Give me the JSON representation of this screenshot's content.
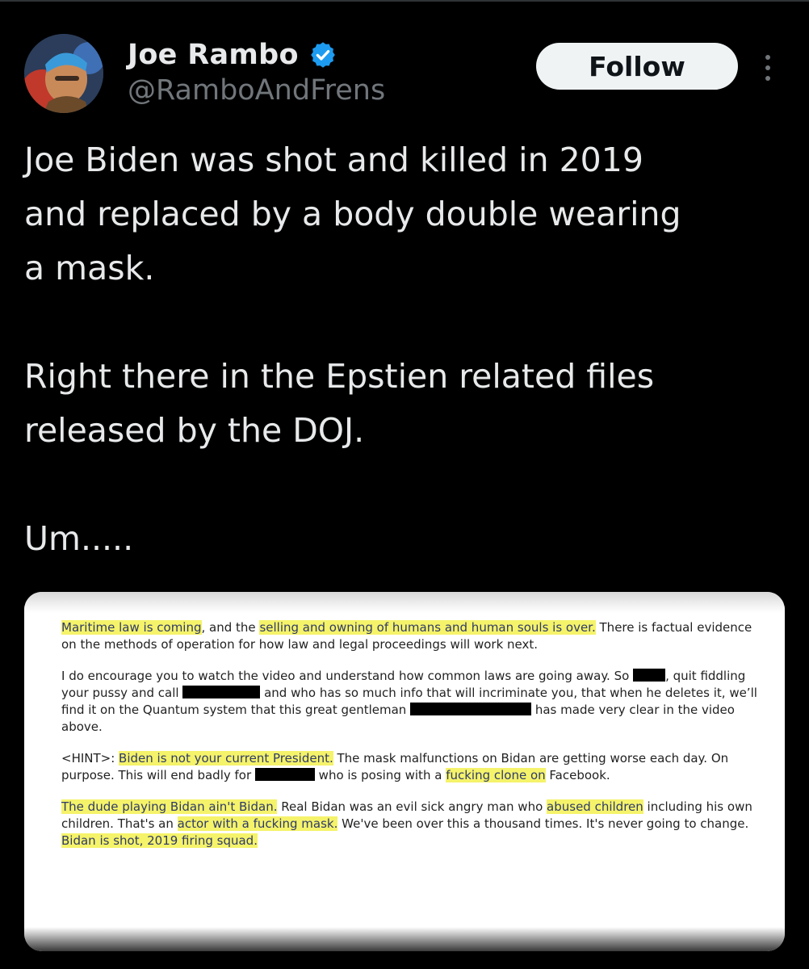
{
  "author": {
    "name": "Joe Rambo",
    "handle": "@RamboAndFrens",
    "verified_color": "#1d9bf0"
  },
  "follow_label": "Follow",
  "more_icon": "more-vertical-icon",
  "tweet_text": "Joe Biden was shot and killed in 2019\nand replaced by a body double wearing\na mask.\n\nRight there in the Epstien related files\nreleased by the DOJ.\n\nUm.....",
  "document": {
    "p1": {
      "hl1": "Maritime law is coming",
      "t1": ", and the ",
      "hl2": "selling and owning of humans and human souls is over.",
      "t2": " There is factual evidence on the methods of operation for how law and legal proceedings will work next."
    },
    "p2": {
      "t1": "I do encourage you to watch the video and understand how common laws are going away. So ",
      "t2": ", quit fiddling your pussy and call ",
      "t3": " and who has so much info that will incriminate you, that when he deletes it, we’ll find it on the Quantum system that this great gentleman ",
      "t4": " has made very clear in the video above."
    },
    "p3": {
      "t1": "<HINT>: ",
      "hl1": "Biden is not your current President.",
      "t2": " The mask malfunctions on Bidan are getting worse each day. On purpose. This will end badly for ",
      "t3": " who is posing with a ",
      "hl2": "fucking clone on",
      "t4": " Facebook."
    },
    "p4": {
      "hl1": "The dude playing Bidan ain't Bidan.",
      "t1": " Real Bidan was an evil sick angry man who ",
      "hl2": "abused children",
      "t2": " including his own children. That's an ",
      "hl3": "actor with a fucking mask.",
      "t3": " We've been over this a thousand times. It's never going to change. ",
      "hl4": "Bidan is shot, 2019 firing squad."
    }
  },
  "colors": {
    "background": "#000000",
    "text": "#e7e9ea",
    "secondary": "#71767b",
    "highlight": "#f5f36a"
  }
}
